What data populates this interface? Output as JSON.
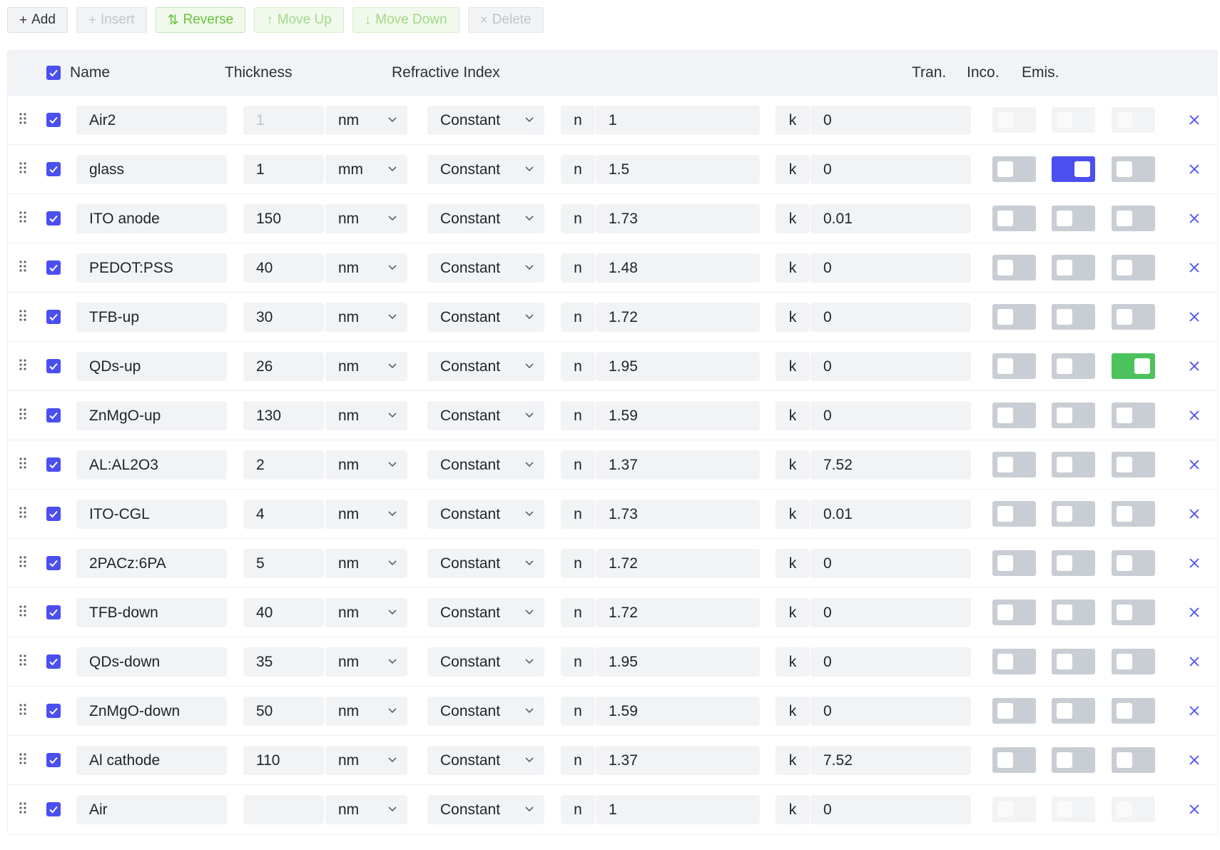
{
  "toolbar": {
    "add": "Add",
    "insert": "Insert",
    "reverse": "Reverse",
    "move_up": "Move Up",
    "move_down": "Move Down",
    "delete": "Delete"
  },
  "columns": {
    "name": "Name",
    "thickness": "Thickness",
    "refractive_index": "Refractive Index",
    "tran": "Tran.",
    "inco": "Inco.",
    "emis": "Emis."
  },
  "colors": {
    "accent_blue": "#4b4ff0",
    "accent_green": "#4cc25c",
    "reverse_green": "#67c23a"
  },
  "rows": [
    {
      "name": "Air2",
      "thickness": "1",
      "unit": "nm",
      "model": "Constant",
      "n": "1",
      "k": "0",
      "tran": "off",
      "inco": "off",
      "emis": "off",
      "toggles_disabled": true,
      "thickness_disabled": true
    },
    {
      "name": "glass",
      "thickness": "1",
      "unit": "mm",
      "model": "Constant",
      "n": "1.5",
      "k": "0",
      "tran": "off",
      "inco": "on",
      "emis": "off",
      "toggles_disabled": false,
      "thickness_disabled": false
    },
    {
      "name": "ITO anode",
      "thickness": "150",
      "unit": "nm",
      "model": "Constant",
      "n": "1.73",
      "k": "0.01",
      "tran": "off",
      "inco": "off",
      "emis": "off",
      "toggles_disabled": false,
      "thickness_disabled": false
    },
    {
      "name": "PEDOT:PSS",
      "thickness": "40",
      "unit": "nm",
      "model": "Constant",
      "n": "1.48",
      "k": "0",
      "tran": "off",
      "inco": "off",
      "emis": "off",
      "toggles_disabled": false,
      "thickness_disabled": false
    },
    {
      "name": "TFB-up",
      "thickness": "30",
      "unit": "nm",
      "model": "Constant",
      "n": "1.72",
      "k": "0",
      "tran": "off",
      "inco": "off",
      "emis": "off",
      "toggles_disabled": false,
      "thickness_disabled": false
    },
    {
      "name": "QDs-up",
      "thickness": "26",
      "unit": "nm",
      "model": "Constant",
      "n": "1.95",
      "k": "0",
      "tran": "off",
      "inco": "off",
      "emis": "on",
      "toggles_disabled": false,
      "thickness_disabled": false
    },
    {
      "name": "ZnMgO-up",
      "thickness": "130",
      "unit": "nm",
      "model": "Constant",
      "n": "1.59",
      "k": "0",
      "tran": "off",
      "inco": "off",
      "emis": "off",
      "toggles_disabled": false,
      "thickness_disabled": false
    },
    {
      "name": "AL:AL2O3",
      "thickness": "2",
      "unit": "nm",
      "model": "Constant",
      "n": "1.37",
      "k": "7.52",
      "tran": "off",
      "inco": "off",
      "emis": "off",
      "toggles_disabled": false,
      "thickness_disabled": false
    },
    {
      "name": "ITO-CGL",
      "thickness": "4",
      "unit": "nm",
      "model": "Constant",
      "n": "1.73",
      "k": "0.01",
      "tran": "off",
      "inco": "off",
      "emis": "off",
      "toggles_disabled": false,
      "thickness_disabled": false
    },
    {
      "name": "2PACz:6PA",
      "thickness": "5",
      "unit": "nm",
      "model": "Constant",
      "n": "1.72",
      "k": "0",
      "tran": "off",
      "inco": "off",
      "emis": "off",
      "toggles_disabled": false,
      "thickness_disabled": false
    },
    {
      "name": "TFB-down",
      "thickness": "40",
      "unit": "nm",
      "model": "Constant",
      "n": "1.72",
      "k": "0",
      "tran": "off",
      "inco": "off",
      "emis": "off",
      "toggles_disabled": false,
      "thickness_disabled": false
    },
    {
      "name": "QDs-down",
      "thickness": "35",
      "unit": "nm",
      "model": "Constant",
      "n": "1.95",
      "k": "0",
      "tran": "off",
      "inco": "off",
      "emis": "off",
      "toggles_disabled": false,
      "thickness_disabled": false
    },
    {
      "name": "ZnMgO-down",
      "thickness": "50",
      "unit": "nm",
      "model": "Constant",
      "n": "1.59",
      "k": "0",
      "tran": "off",
      "inco": "off",
      "emis": "off",
      "toggles_disabled": false,
      "thickness_disabled": false
    },
    {
      "name": "Al cathode",
      "thickness": "110",
      "unit": "nm",
      "model": "Constant",
      "n": "1.37",
      "k": "7.52",
      "tran": "off",
      "inco": "off",
      "emis": "off",
      "toggles_disabled": false,
      "thickness_disabled": false
    },
    {
      "name": "Air",
      "thickness": "",
      "unit": "nm",
      "model": "Constant",
      "n": "1",
      "k": "0",
      "tran": "off",
      "inco": "off",
      "emis": "off",
      "toggles_disabled": true,
      "thickness_disabled": false
    }
  ],
  "labels": {
    "n": "n",
    "k": "k"
  }
}
